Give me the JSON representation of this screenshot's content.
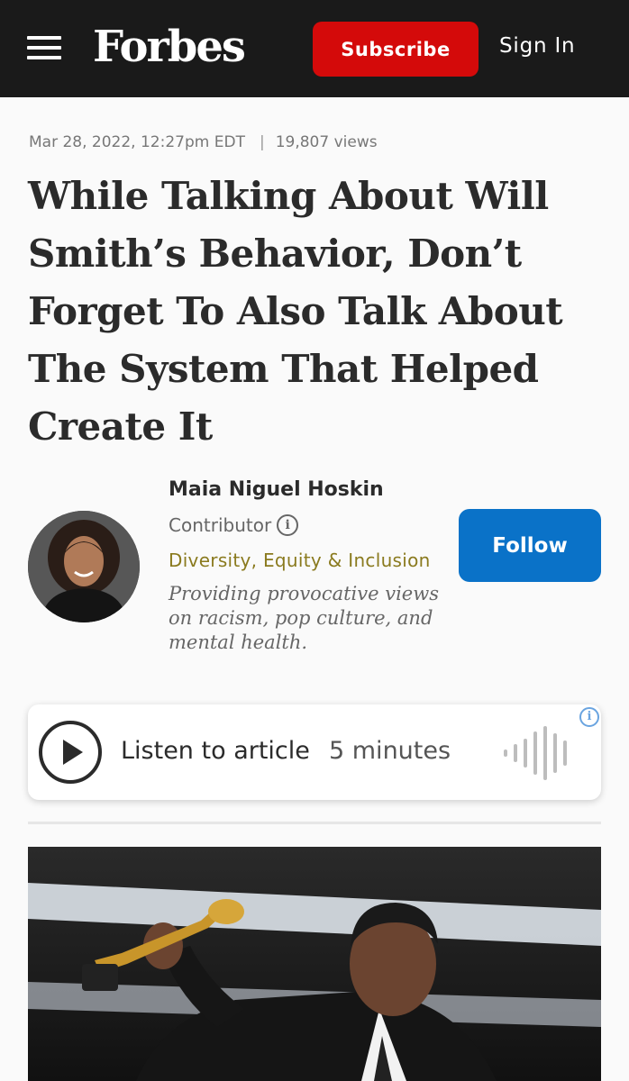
{
  "header": {
    "logo": "Forbes",
    "subscribe_label": "Subscribe",
    "signin_label": "Sign In"
  },
  "article": {
    "date": "Mar 28, 2022, 12:27pm EDT",
    "separator": "|",
    "views": "19,807 views",
    "headline": "While Talking About Will Smith’s Behavior, Don’t Forget To Also Talk About The System That Helped Create It"
  },
  "author": {
    "name": "Maia Niguel Hoskin",
    "role": "Contributor",
    "role_info_icon": "i",
    "topic": "Diversity, Equity & Inclusion",
    "bio": "Providing provocative views on racism, pop culture, and mental health.",
    "follow_label": "Follow"
  },
  "listen": {
    "label": "Listen to article",
    "duration": "5 minutes",
    "info_icon": "i"
  },
  "colors": {
    "header_bg": "#1a1a1a",
    "subscribe_bg": "#d40a0a",
    "follow_bg": "#0a72c8",
    "topic_color": "#8a7a1e"
  }
}
